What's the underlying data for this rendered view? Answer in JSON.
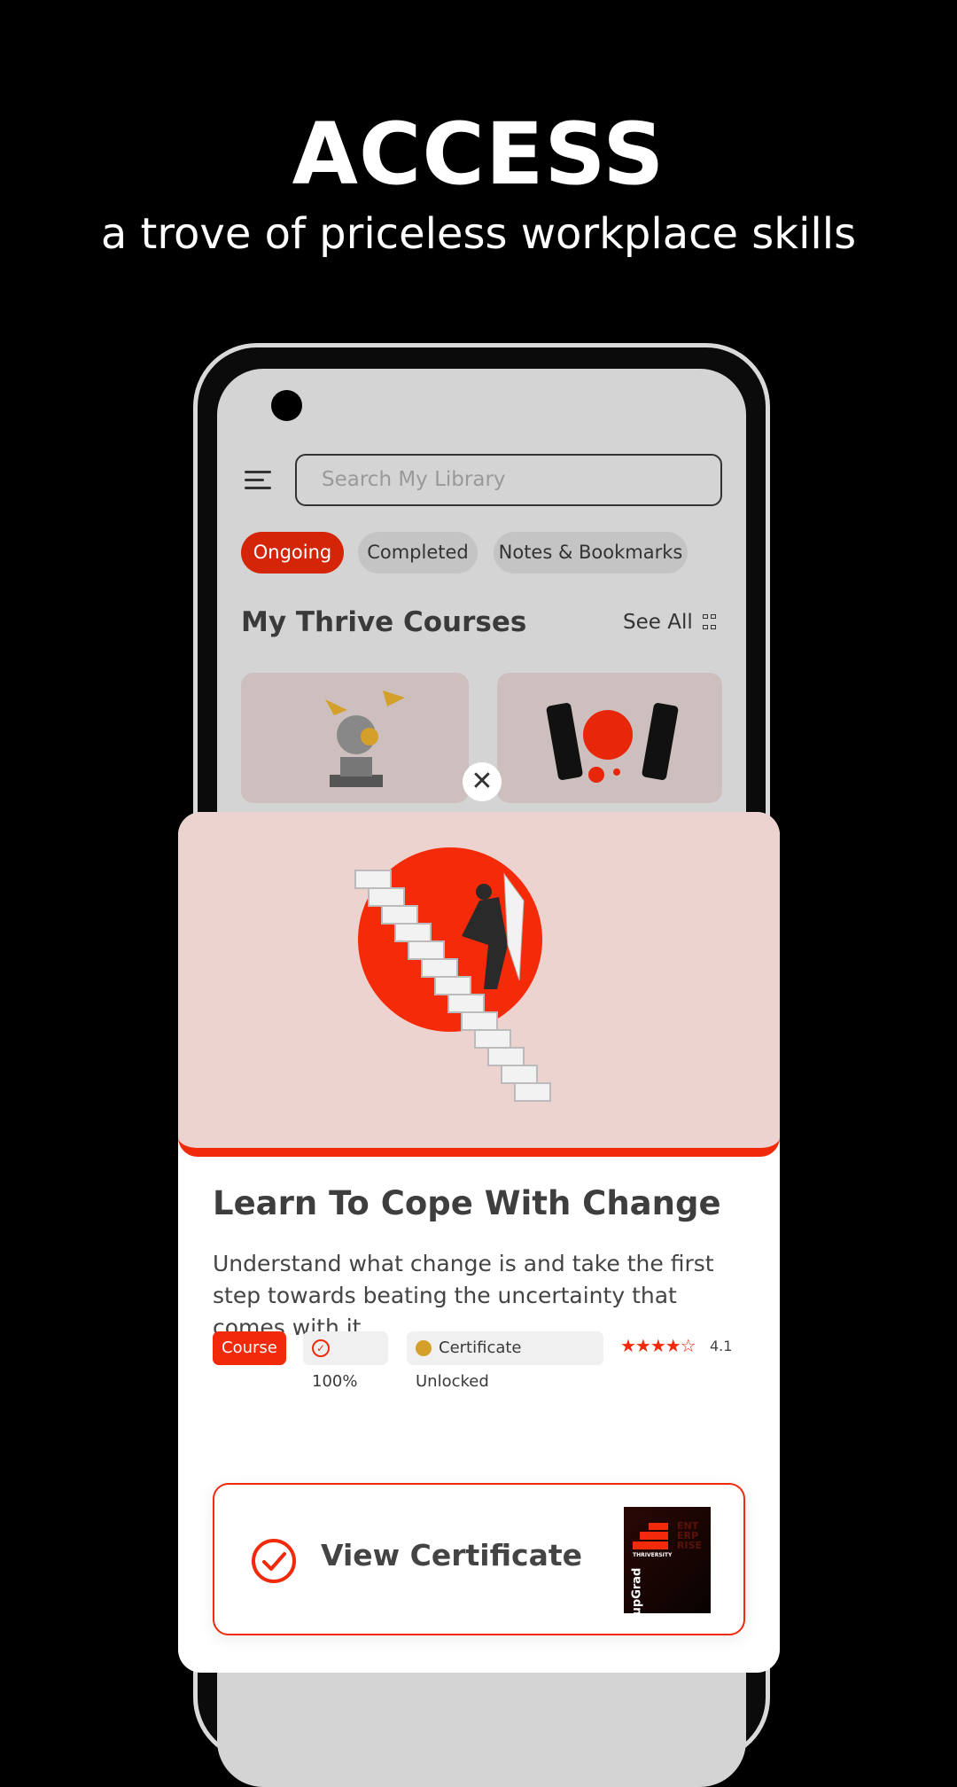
{
  "promo": {
    "headline": "ACCESS",
    "subline": "a trove of priceless workplace skills"
  },
  "library": {
    "search_placeholder": "Search My Library",
    "tabs": [
      {
        "label": "Ongoing",
        "active": true
      },
      {
        "label": "Completed",
        "active": false
      },
      {
        "label": "Notes & Bookmarks",
        "active": false
      }
    ],
    "section_title": "My Thrive Courses",
    "see_all": "See All"
  },
  "course_card": {
    "title": "Learn To Cope With Change",
    "description": "Understand what change is and take the first step towards beating the uncertainty that comes with it",
    "type_badge": "Course",
    "progress": "100%",
    "certificate_status": "Certificate Unlocked",
    "rating": "4.1",
    "stars_filled": 4,
    "view_certificate": "View Certificate",
    "certificate_logo_text": [
      "THRIVERSITY",
      "upGrad",
      "ENTERPRISE"
    ]
  },
  "colors": {
    "accent": "#f02a0a",
    "coin": "#d4a02a"
  }
}
